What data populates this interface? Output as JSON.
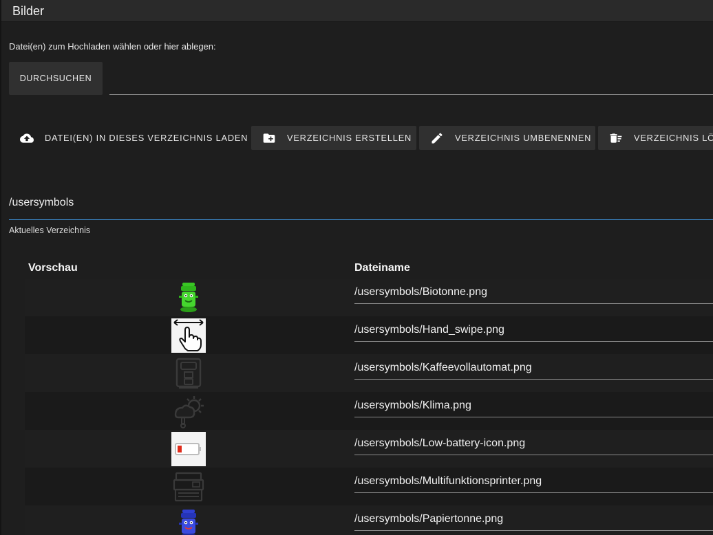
{
  "window": {
    "title": "Bilder"
  },
  "upload": {
    "hint": "Datei(en) zum Hochladen wählen oder hier ablegen:",
    "browse_label": "DURCHSUCHEN"
  },
  "actions": {
    "upload_label": "DATEI(EN) IN DIESES VERZEICHNIS LADEN",
    "create_label": "VERZEICHNIS ERSTELLEN",
    "rename_label": "VERZEICHNIS UMBENENNEN",
    "delete_label": "VERZEICHNIS LÖSCHEN"
  },
  "directory": {
    "value": "/usersymbols",
    "label": "Aktuelles Verzeichnis"
  },
  "table": {
    "col_preview": "Vorschau",
    "col_name": "Dateiname",
    "rows": [
      {
        "name": "/usersymbols/Biotonne.png",
        "icon": "green-bin-icon"
      },
      {
        "name": "/usersymbols/Hand_swipe.png",
        "icon": "hand-swipe-icon"
      },
      {
        "name": "/usersymbols/Kaffeevollautomat.png",
        "icon": "coffee-machine-icon"
      },
      {
        "name": "/usersymbols/Klima.png",
        "icon": "climate-icon"
      },
      {
        "name": "/usersymbols/Low-battery-icon.png",
        "icon": "low-battery-icon"
      },
      {
        "name": "/usersymbols/Multifunktionsprinter.png",
        "icon": "printer-icon"
      },
      {
        "name": "/usersymbols/Papiertonne.png",
        "icon": "blue-bin-icon"
      }
    ]
  },
  "colors": {
    "background": "#1e1e1e",
    "accent": "#3d8fd6",
    "button": "#303030"
  }
}
